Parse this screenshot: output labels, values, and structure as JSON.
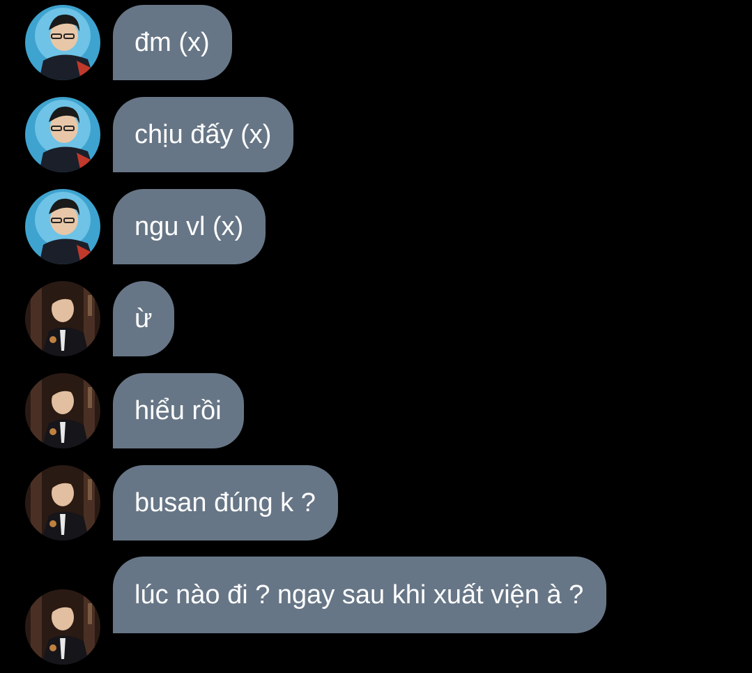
{
  "conversation": {
    "messages": [
      {
        "sender": "avatar-a",
        "text": "đm (x)"
      },
      {
        "sender": "avatar-a",
        "text": "chịu đấy (x)"
      },
      {
        "sender": "avatar-a",
        "text": "ngu vl (x)"
      },
      {
        "sender": "avatar-b",
        "text": "ừ"
      },
      {
        "sender": "avatar-b",
        "text": "hiểu rồi"
      },
      {
        "sender": "avatar-b",
        "text": "busan đúng k ?"
      },
      {
        "sender": "avatar-b",
        "text": "lúc nào đi ? ngay sau khi xuất viện à ?"
      }
    ]
  },
  "colors": {
    "background": "#000000",
    "bubble": "#677686",
    "text": "#ffffff"
  }
}
